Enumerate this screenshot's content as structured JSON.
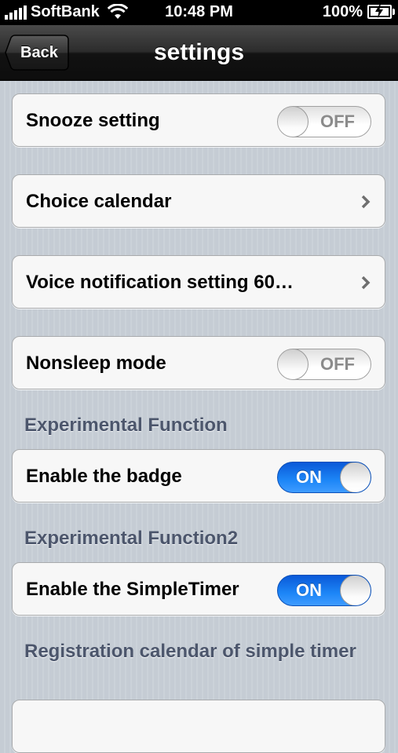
{
  "status_bar": {
    "carrier": "SoftBank",
    "time": "10:48 PM",
    "battery": "100%",
    "signal_bars": 5
  },
  "nav": {
    "back_label": "Back",
    "title": "settings"
  },
  "cells": {
    "snooze": {
      "label": "Snooze setting",
      "toggle": "OFF"
    },
    "choice_calendar": {
      "label": "Choice calendar"
    },
    "voice_notification": {
      "label": "Voice notification setting 60…"
    },
    "nonsleep": {
      "label": "Nonsleep mode",
      "toggle": "OFF"
    },
    "badge": {
      "label": "Enable the badge",
      "toggle": "ON"
    },
    "simple_timer": {
      "label": "Enable the SimpleTimer",
      "toggle": "ON"
    }
  },
  "sections": {
    "experimental": "Experimental Function",
    "experimental2": "Experimental Function2",
    "registration": "Registration calendar of simple timer"
  },
  "colors": {
    "toggle_on": "#1d86f7",
    "section_header": "#4c566c",
    "cell_bg": "#f7f7f7"
  },
  "icons": [
    "signal-icon",
    "wifi-icon",
    "battery-icon",
    "chevron-right-icon",
    "back-arrow-icon"
  ]
}
